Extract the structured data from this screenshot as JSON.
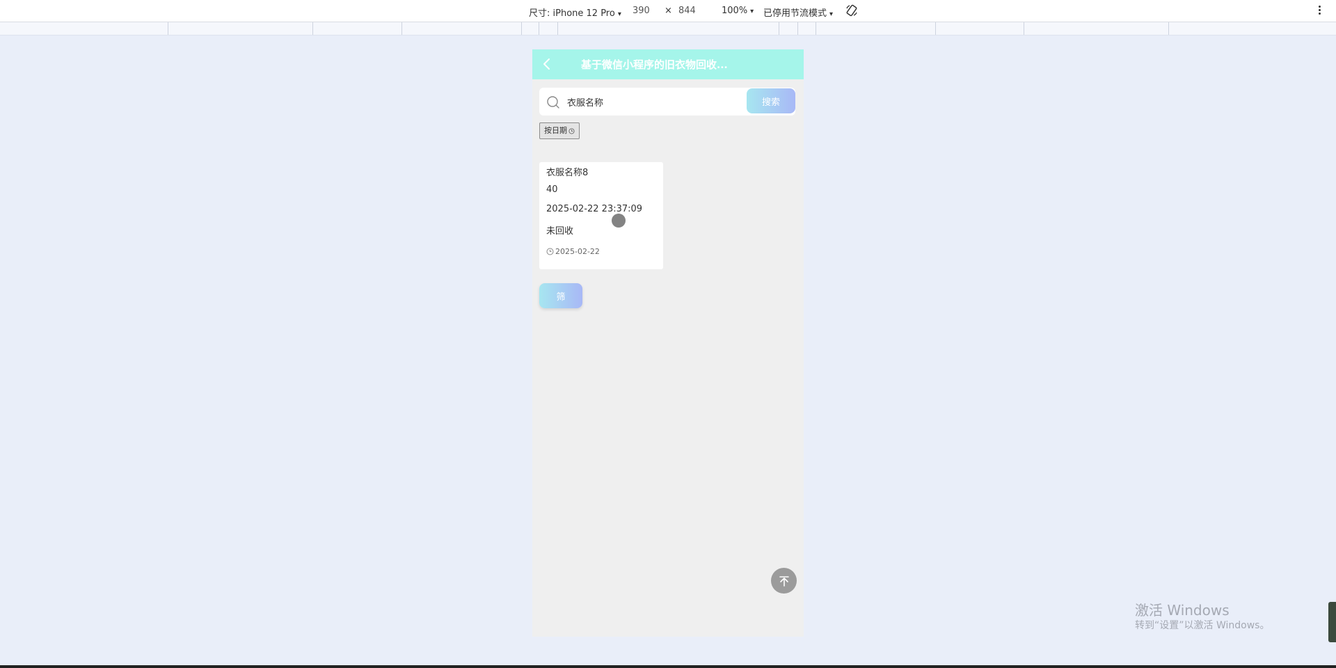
{
  "devtools": {
    "dimensions_label": "尺寸: iPhone 12 Pro",
    "width": "390",
    "times": "×",
    "height": "844",
    "zoom": "100%",
    "throttle": "已停用节流模式",
    "caret": "▾",
    "icons": [
      "rotate-icon",
      "more-vert-icon"
    ]
  },
  "app": {
    "nav_title": "基于微信小程序的旧衣物回收...",
    "search": {
      "value": "衣服名称",
      "button_label": "搜索"
    },
    "sort_chip_label": "按日期",
    "cards": [
      {
        "name": "衣服名称8",
        "price": "40",
        "datetime": "2025-02-22 23:37:09",
        "status": "未回收",
        "date": "2025-02-22"
      }
    ],
    "filter_button_label": "筛"
  },
  "watermark": {
    "title": "激活 Windows",
    "subtitle": "转到“设置”以激活 Windows。"
  },
  "colors": {
    "nav_bg": "#a5f5ea",
    "button_gradient_start": "#a7e6f0",
    "button_gradient_end": "#a8b8f6",
    "page_bg": "#efefef",
    "outer_bg": "#e9eef9"
  }
}
